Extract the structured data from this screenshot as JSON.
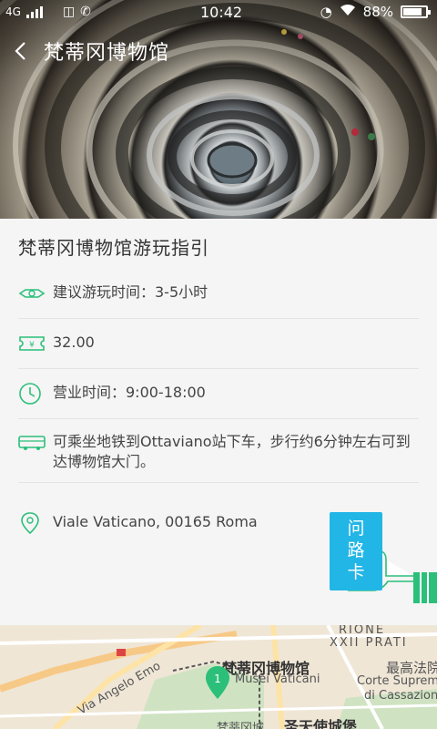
{
  "status_bar": {
    "network": "4G",
    "time": "10:42",
    "battery": "88%"
  },
  "header": {
    "title": "梵蒂冈博物馆"
  },
  "guide": {
    "title": "梵蒂冈博物馆游玩指引",
    "items": [
      {
        "icon": "duration-icon",
        "text": "建议游玩时间：3-5小时"
      },
      {
        "icon": "ticket-icon",
        "text": "32.00"
      },
      {
        "icon": "clock-icon",
        "text": "营业时间：9:00-18:00"
      },
      {
        "icon": "bus-icon",
        "text": "可乘坐地铁到Ottaviano站下车，步行约6分钟左右可到达博物馆大门。"
      },
      {
        "icon": "location-icon",
        "text": "Viale Vaticano, 00165 Roma"
      }
    ],
    "ticket_icon_symbol": "¥",
    "accent_color": "#2bbf7a"
  },
  "card_button": {
    "chars": [
      "问",
      "路",
      "卡"
    ],
    "color": "#22b6e6"
  },
  "map": {
    "labels": {
      "rione": "RIONE",
      "xxii_prati": "XXII PRATI",
      "museum": "梵蒂冈博物馆",
      "musei_vaticani": "Musei Vaticani",
      "via_angelo_emo": "Via Angelo Emo",
      "court": "最高法院",
      "corte_suprema": "Corte Suprem",
      "di_cassazione": "di Cassazione",
      "castel": "圣天使城堡",
      "partial": "梵蒂冈城"
    },
    "marker_number": "1"
  }
}
